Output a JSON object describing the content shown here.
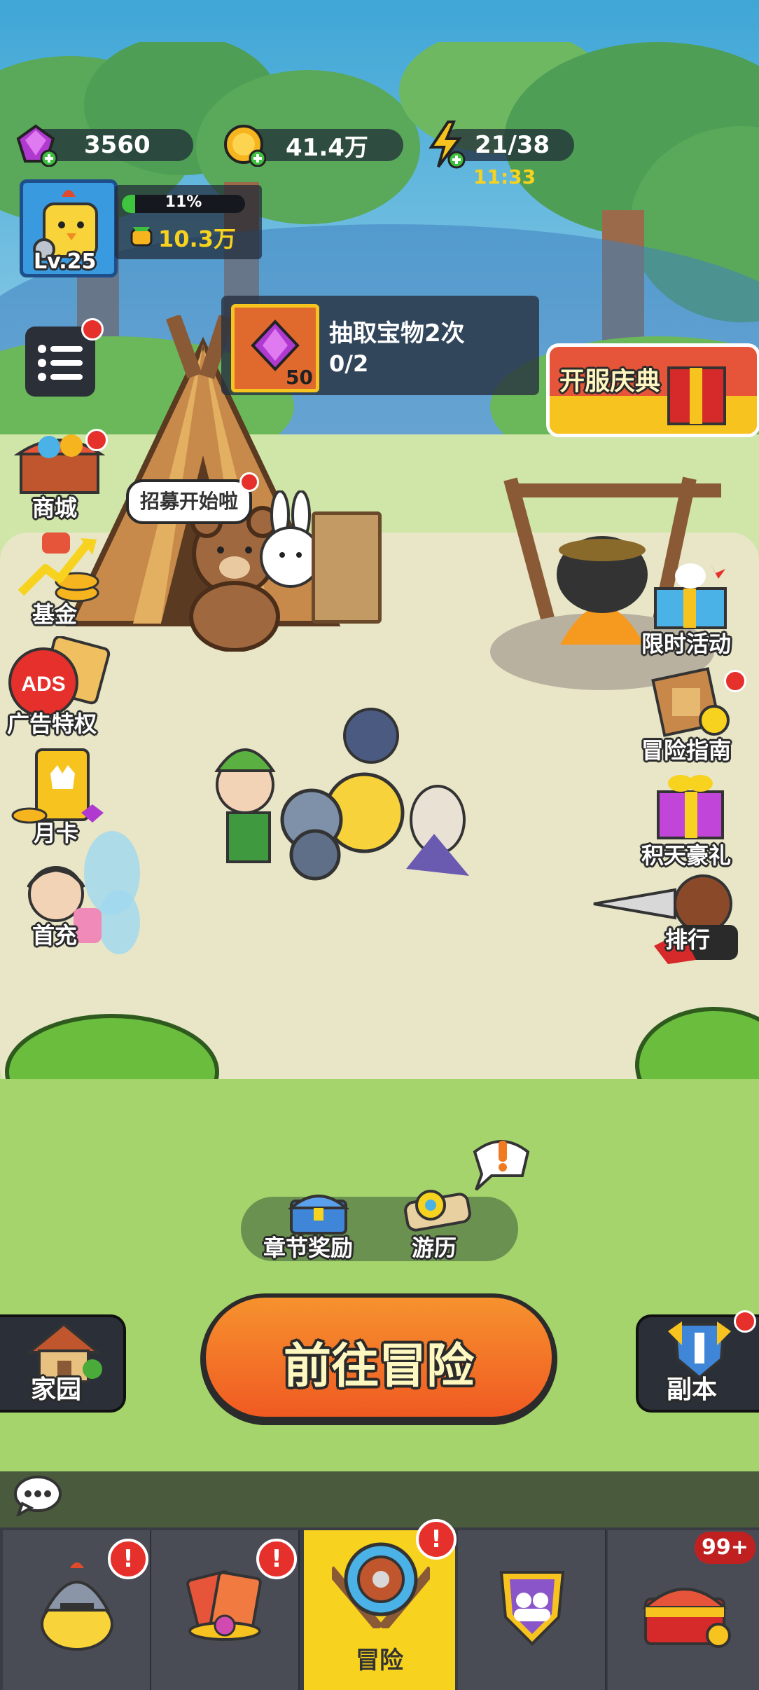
{
  "hud": {
    "gems": "3560",
    "gold": "41.4万",
    "energy": "21/38",
    "energy_timer": "11:33",
    "level": "Lv.25",
    "exp_percent_label": "11%",
    "exp_progress": 0.11,
    "power": "10.3万"
  },
  "task": {
    "title": "抽取宝物2次",
    "progress": "0/2",
    "item_count": "50"
  },
  "banner": {
    "label": "开服庆典"
  },
  "left_menu": [
    {
      "label": "商城"
    },
    {
      "label": "基金"
    },
    {
      "label": "广告特权",
      "badge": "ADS"
    },
    {
      "label": "月卡"
    },
    {
      "label": "首充"
    }
  ],
  "right_menu": [
    {
      "label": "限时活动"
    },
    {
      "label": "冒险指南"
    },
    {
      "label": "积天豪礼"
    },
    {
      "label": "排行"
    }
  ],
  "speech_bubble": "招募开始啦",
  "bottom_hub": {
    "chapter_reward": "章节奖励",
    "journey": "游历"
  },
  "home_label": "家园",
  "main_button": "前往冒险",
  "dungeon_label": "副本",
  "nav": {
    "tabs": [
      {
        "name": "heroes",
        "label": ""
      },
      {
        "name": "cards",
        "label": ""
      },
      {
        "name": "adventure",
        "label": "冒险"
      },
      {
        "name": "guild",
        "label": ""
      },
      {
        "name": "treasure",
        "label": ""
      }
    ],
    "treasure_badge": "99+",
    "alert_mark": "!"
  },
  "colors": {
    "accent_yellow": "#f7d21e",
    "main_button_orange": "#f05a22",
    "alert_red": "#e6302c"
  }
}
